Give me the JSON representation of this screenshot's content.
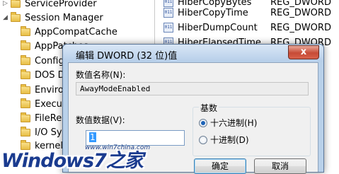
{
  "registry": {
    "tree_items": [
      {
        "label": "ServiceProvider",
        "expanded": false
      },
      {
        "label": "Session Manager",
        "expanded": true
      },
      {
        "label": "AppCompatCache"
      },
      {
        "label": "AppPatches"
      },
      {
        "label": "Configuration"
      },
      {
        "label": "DOS Devices"
      },
      {
        "label": "Environment"
      },
      {
        "label": "Executive"
      },
      {
        "label": "FileRename"
      },
      {
        "label": "I/O System"
      },
      {
        "label": "kernel"
      }
    ],
    "values": [
      {
        "name": "HiberCopyBytes",
        "type": "REG_DWORD"
      },
      {
        "name": "HiberCopyTime",
        "type": "REG_DWORD"
      },
      {
        "name": "HiberDumpCount",
        "type": "REG_DWORD"
      },
      {
        "name": "HiberElapsedTime",
        "type": "REG_DWORD"
      }
    ]
  },
  "dialog": {
    "title": "编辑 DWORD (32 位)值",
    "close_glyph": "x",
    "value_name_label": "数值名称(N):",
    "value_name": "AwayModeEnabled",
    "value_data_label": "数值数据(V):",
    "value_data": "1",
    "base_label": "基数",
    "base_options": [
      {
        "label": "十六进制(H)",
        "checked": true
      },
      {
        "label": "十进制(D)",
        "checked": false
      }
    ],
    "ok_label": "确定",
    "cancel_label": "取消"
  },
  "watermark": {
    "logo": "Windows7之家",
    "url": "www.win7china.com"
  }
}
